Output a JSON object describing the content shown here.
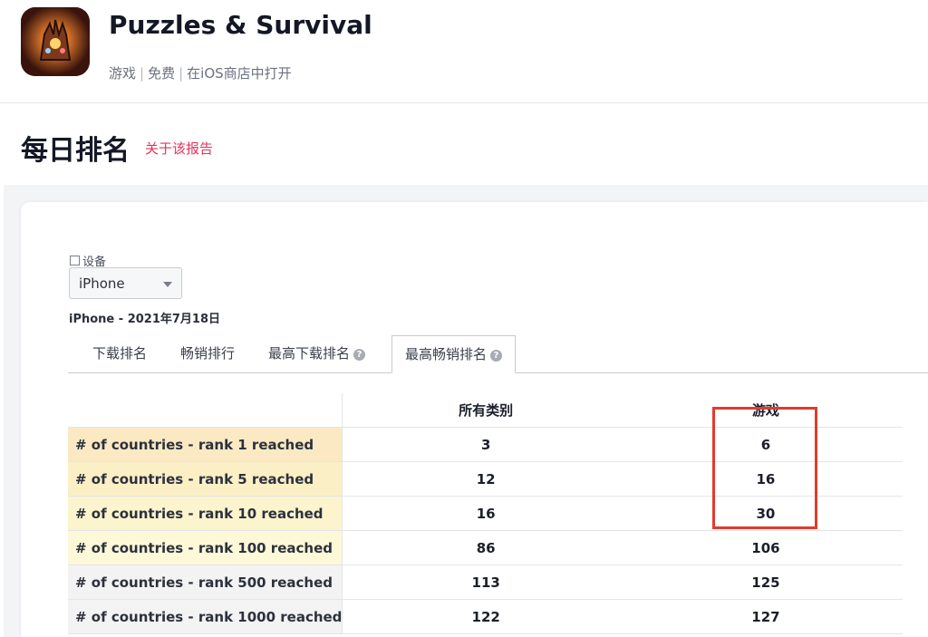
{
  "app": {
    "title": "Puzzles & Survival",
    "meta": {
      "category": "游戏",
      "price": "免费",
      "store_link": "在iOS商店中打开"
    }
  },
  "section": {
    "title": "每日排名",
    "report_link": "关于该报告"
  },
  "device": {
    "label": "设备",
    "selected": "iPhone"
  },
  "subtitle": "iPhone - 2021年7月18日",
  "tabs": [
    {
      "label": "下载排名",
      "active": false
    },
    {
      "label": "畅销排行",
      "active": false
    },
    {
      "label": "最高下载排名",
      "active": false,
      "help": true
    },
    {
      "label": "最高畅销排名",
      "active": true,
      "help": true
    }
  ],
  "table": {
    "columns": [
      "",
      "所有类别",
      "游戏"
    ],
    "rows": [
      {
        "label": "# of countries - rank 1 reached",
        "all": "3",
        "games": "6",
        "bg": "#fbe9c3"
      },
      {
        "label": "# of countries - rank 5 reached",
        "all": "12",
        "games": "16",
        "bg": "#fbefc6"
      },
      {
        "label": "# of countries - rank 10 reached",
        "all": "16",
        "games": "30",
        "bg": "#fcf4cd"
      },
      {
        "label": "# of countries - rank 100 reached",
        "all": "86",
        "games": "106",
        "bg": "#fdf9d8"
      },
      {
        "label": "# of countries - rank 500 reached",
        "all": "113",
        "games": "125",
        "bg": "#f3f3f3"
      },
      {
        "label": "# of countries - rank 1000 reached",
        "all": "122",
        "games": "127",
        "bg": "#f3f3f3"
      }
    ]
  },
  "colors": {
    "accent_link": "#e8325f",
    "highlight_box": "#e23b2b"
  }
}
